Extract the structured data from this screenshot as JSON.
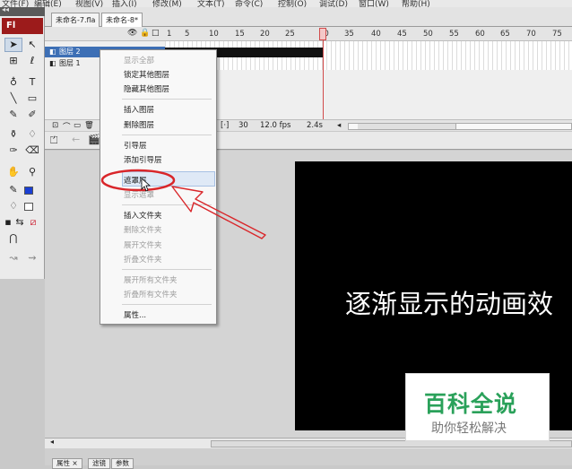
{
  "menubar": {
    "items": [
      "文件(F)",
      "编辑(E)",
      "视图(V)",
      "插入(I)",
      "修改(M)",
      "文本(T)",
      "命令(C)",
      "控制(O)",
      "调试(D)",
      "窗口(W)",
      "帮助(H)"
    ]
  },
  "tools_panel": {
    "logo": "Fl",
    "collapse": "◂◂"
  },
  "document_tabs": [
    {
      "label": "未命名-7.fla"
    },
    {
      "label": "未命名-8*"
    }
  ],
  "timeline": {
    "ruler": [
      "1",
      "5",
      "10",
      "15",
      "20",
      "25",
      "30",
      "35",
      "40",
      "45",
      "50",
      "55",
      "60",
      "65",
      "70",
      "75"
    ],
    "layers": [
      {
        "name": "图层 2"
      },
      {
        "name": "图层 1"
      }
    ],
    "footer": {
      "current_frame": "30",
      "fps": "12.0 fps",
      "time": "2.4s"
    }
  },
  "context_menu": {
    "items": [
      {
        "label": "显示全部",
        "enabled": false
      },
      {
        "label": "锁定其他图层",
        "enabled": true
      },
      {
        "label": "隐藏其他图层",
        "enabled": true
      },
      {
        "label": "插入图层",
        "enabled": true
      },
      {
        "label": "删除图层",
        "enabled": true
      },
      {
        "label": "引导层",
        "enabled": true
      },
      {
        "label": "添加引导层",
        "enabled": true
      },
      {
        "label": "遮罩层",
        "enabled": true,
        "highlighted": true
      },
      {
        "label": "显示遮罩",
        "enabled": false
      },
      {
        "label": "插入文件夹",
        "enabled": true
      },
      {
        "label": "删除文件夹",
        "enabled": false
      },
      {
        "label": "展开文件夹",
        "enabled": false
      },
      {
        "label": "折叠文件夹",
        "enabled": false
      },
      {
        "label": "展开所有文件夹",
        "enabled": false
      },
      {
        "label": "折叠所有文件夹",
        "enabled": false
      },
      {
        "label": "属性...",
        "enabled": true
      }
    ]
  },
  "stage": {
    "text": "逐渐显示的动画效"
  },
  "bottom_panel": {
    "tabs": [
      "属性 ×",
      "滤镜",
      "参数"
    ]
  },
  "watermark": {
    "title": "百科全说",
    "subtitle": "助你轻松解决"
  },
  "colors": {
    "selection_blue": "#3d6fb5",
    "annotation_red": "#d9262a",
    "watermark_green": "#2aa15a",
    "logo_red": "#9c1b1b"
  }
}
